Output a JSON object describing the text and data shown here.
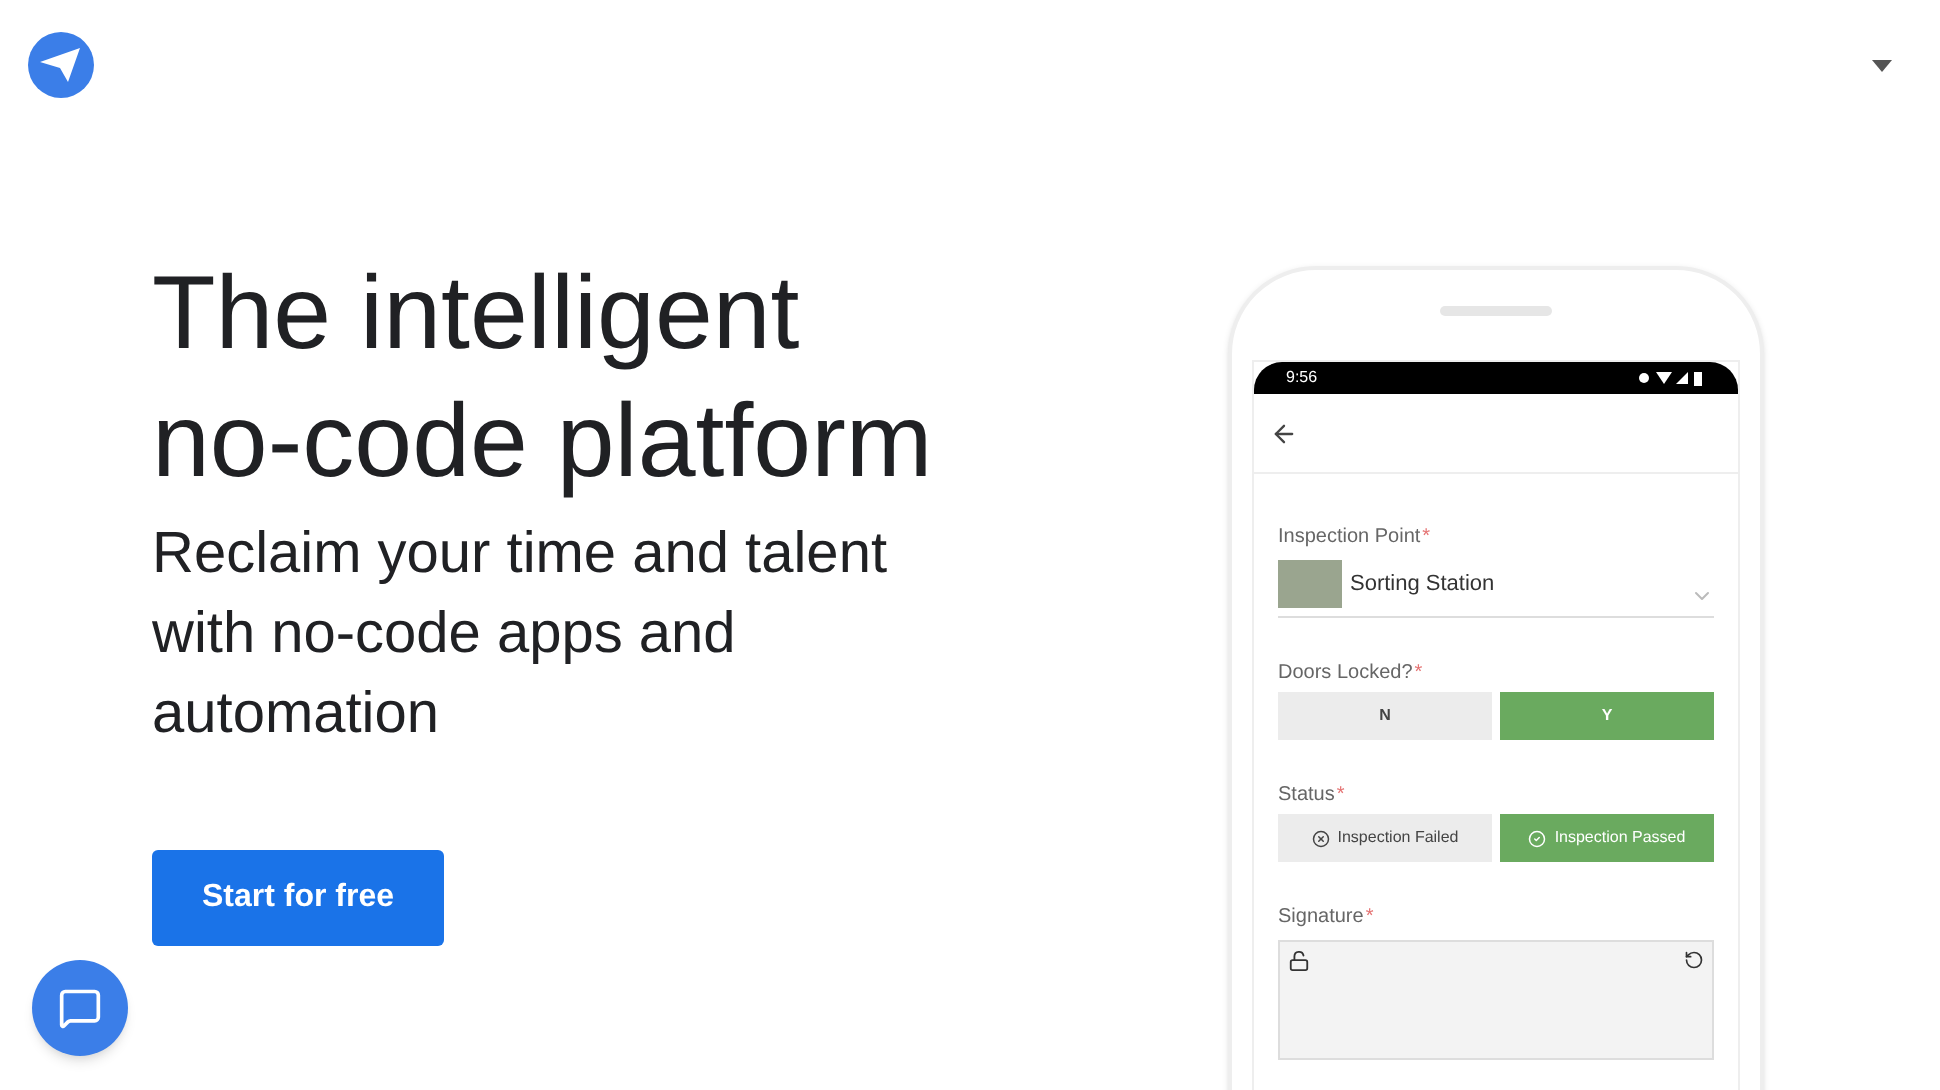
{
  "hero": {
    "title_lines": [
      "The intelligent",
      "no-code platform"
    ],
    "subtitle": "Reclaim your time and talent with no-code apps and automation",
    "cta": "Start for free"
  },
  "phone": {
    "time": "9:56",
    "fields": [
      {
        "kind": "select",
        "label": "Inspection Point",
        "required_mark": "*",
        "value": "Sorting Station"
      },
      {
        "kind": "toggle",
        "label": "Doors Locked?",
        "required_mark": "*",
        "options": [
          {
            "kind": "plain",
            "label": "N",
            "selected": false
          },
          {
            "kind": "plain",
            "label": "Y",
            "selected": true
          }
        ]
      },
      {
        "kind": "toggle",
        "label": "Status",
        "required_mark": "*",
        "options": [
          {
            "kind": "failed",
            "label": "Inspection Failed",
            "selected": false
          },
          {
            "kind": "passed",
            "label": "Inspection Passed",
            "selected": true
          }
        ]
      },
      {
        "kind": "signature",
        "label": "Signature",
        "required_mark": "*"
      }
    ]
  }
}
